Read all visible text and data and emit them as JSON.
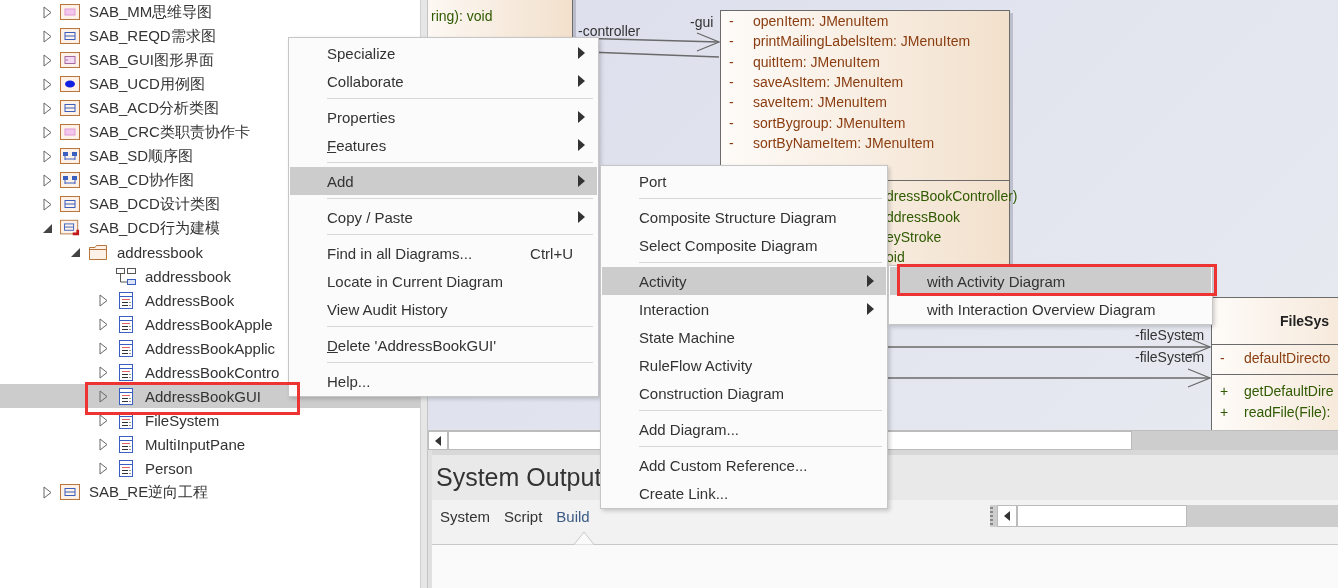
{
  "tree": {
    "items": [
      {
        "label": "SAB_MM思维导图",
        "kind": "mindmap",
        "expanded": false,
        "selected": false
      },
      {
        "label": "SAB_REQD需求图",
        "kind": "requirements",
        "expanded": false,
        "selected": false
      },
      {
        "label": "SAB_GUI图形界面",
        "kind": "gui",
        "expanded": false,
        "selected": false
      },
      {
        "label": "SAB_UCD用例图",
        "kind": "usecase",
        "expanded": false,
        "selected": false
      },
      {
        "label": "SAB_ACD分析类图",
        "kind": "analysis",
        "expanded": false,
        "selected": false
      },
      {
        "label": "SAB_CRC类职责协作卡",
        "kind": "crc",
        "expanded": false,
        "selected": false
      },
      {
        "label": "SAB_SD顺序图",
        "kind": "sequence",
        "expanded": false,
        "selected": false
      },
      {
        "label": "SAB_CD协作图",
        "kind": "collaboration",
        "expanded": false,
        "selected": false
      },
      {
        "label": "SAB_DCD设计类图",
        "kind": "analysis",
        "expanded": false,
        "selected": false
      },
      {
        "label": "SAB_DCD行为建模",
        "kind": "behavior",
        "expanded": true,
        "selected": false,
        "children": [
          {
            "label": "addressbook",
            "kind": "folder",
            "expanded": true,
            "selected": false,
            "children": [
              {
                "label": "addressbook",
                "kind": "diagram",
                "selected": false
              },
              {
                "label": "AddressBook",
                "kind": "class",
                "expanded": false,
                "selected": false
              },
              {
                "label": "AddressBookApple",
                "kind": "class",
                "expanded": false,
                "selected": false
              },
              {
                "label": "AddressBookApplic",
                "kind": "class",
                "expanded": false,
                "selected": false
              },
              {
                "label": "AddressBookContro",
                "kind": "class",
                "expanded": false,
                "selected": false
              },
              {
                "label": "AddressBookGUI",
                "kind": "class",
                "expanded": false,
                "selected": true,
                "highlighted": true
              },
              {
                "label": "FileSystem",
                "kind": "class",
                "expanded": false,
                "selected": false
              },
              {
                "label": "MultiInputPane",
                "kind": "class",
                "expanded": false,
                "selected": false
              },
              {
                "label": "Person",
                "kind": "class",
                "expanded": false,
                "selected": false
              }
            ]
          }
        ]
      },
      {
        "label": "SAB_RE逆向工程",
        "kind": "analysis",
        "expanded": false,
        "selected": false
      }
    ]
  },
  "diagram": {
    "classes": [
      {
        "operations": [
          {
            "text": "ring): void"
          }
        ]
      },
      {
        "attributes": [
          {
            "visibility": "-",
            "text": "openItem: JMenuItem"
          },
          {
            "visibility": "-",
            "text": "printMailingLabelsItem: JMenuItem"
          },
          {
            "visibility": "-",
            "text": "quitItem: JMenuItem"
          },
          {
            "visibility": "-",
            "text": "saveAsItem: JMenuItem"
          },
          {
            "visibility": "-",
            "text": "saveItem: JMenuItem"
          },
          {
            "visibility": "-",
            "text": "sortBygroup: JMenuItem"
          },
          {
            "visibility": "-",
            "text": "sortByNameItem: JMenuItem"
          }
        ],
        "operations": [
          {
            "text": "dressBookController)"
          },
          {
            "text": "ddressBook"
          },
          {
            "text": "eyStroke"
          },
          {
            "text": "oid"
          }
        ]
      },
      {
        "name": "FileSys",
        "attributes": [
          {
            "visibility": "-",
            "text": "defaultDirecto"
          }
        ],
        "operations": [
          {
            "visibility": "+",
            "text": "getDefaultDire"
          },
          {
            "visibility": "+",
            "text": "readFile(File):"
          }
        ]
      }
    ],
    "connectors": [
      {
        "kind": "association",
        "source_role": "-controller",
        "target_role": "-gui"
      },
      {
        "kind": "association"
      },
      {
        "kind": "association",
        "target_role": "-fileSystem"
      },
      {
        "kind": "association",
        "target_role": "-fileSystem"
      }
    ]
  },
  "context_menu": {
    "items": [
      {
        "kind": "item",
        "label": "Specialize",
        "submenu": true,
        "selected": false
      },
      {
        "kind": "item",
        "label": "Collaborate",
        "submenu": true,
        "selected": false
      },
      {
        "kind": "separator"
      },
      {
        "kind": "item",
        "label": "Properties",
        "submenu": true,
        "selected": false
      },
      {
        "kind": "item",
        "label": "Features",
        "submenu": true,
        "selected": false,
        "underline_first": true
      },
      {
        "kind": "separator"
      },
      {
        "kind": "item",
        "label": "Add",
        "submenu": true,
        "selected": true
      },
      {
        "kind": "separator"
      },
      {
        "kind": "item",
        "label": "Copy / Paste",
        "submenu": true,
        "selected": false
      },
      {
        "kind": "separator"
      },
      {
        "kind": "item",
        "label": "Find in all Diagrams...",
        "shortcut": "Ctrl+U",
        "submenu": false,
        "selected": false
      },
      {
        "kind": "item",
        "label": "Locate in Current Diagram",
        "submenu": false,
        "selected": false
      },
      {
        "kind": "item",
        "label": "View Audit History",
        "submenu": false,
        "selected": false
      },
      {
        "kind": "separator"
      },
      {
        "kind": "item",
        "label": "Delete 'AddressBookGUI'",
        "submenu": false,
        "selected": false,
        "underline_first": true
      },
      {
        "kind": "separator"
      },
      {
        "kind": "item",
        "label": "Help...",
        "submenu": false,
        "selected": false
      }
    ]
  },
  "add_submenu": {
    "items": [
      {
        "kind": "item",
        "label": "Port",
        "submenu": false,
        "selected": false
      },
      {
        "kind": "separator"
      },
      {
        "kind": "item",
        "label": "Composite Structure Diagram",
        "submenu": false,
        "selected": false
      },
      {
        "kind": "item",
        "label": "Select Composite Diagram",
        "submenu": false,
        "selected": false
      },
      {
        "kind": "separator"
      },
      {
        "kind": "item",
        "label": "Activity",
        "submenu": true,
        "selected": true
      },
      {
        "kind": "item",
        "label": "Interaction",
        "submenu": true,
        "selected": false
      },
      {
        "kind": "item",
        "label": "State Machine",
        "submenu": false,
        "selected": false
      },
      {
        "kind": "item",
        "label": "RuleFlow Activity",
        "submenu": false,
        "selected": false
      },
      {
        "kind": "item",
        "label": "Construction Diagram",
        "submenu": false,
        "selected": false
      },
      {
        "kind": "separator"
      },
      {
        "kind": "item",
        "label": "Add Diagram...",
        "submenu": false,
        "selected": false
      },
      {
        "kind": "separator"
      },
      {
        "kind": "item",
        "label": "Add Custom Reference...",
        "submenu": false,
        "selected": false
      },
      {
        "kind": "item",
        "label": "Create Link...",
        "submenu": false,
        "selected": false
      }
    ]
  },
  "activity_submenu": {
    "items": [
      {
        "kind": "item",
        "label": "with Activity Diagram",
        "submenu": false,
        "selected": true,
        "highlighted": true
      },
      {
        "kind": "item",
        "label": "with Interaction Overview Diagram",
        "submenu": false,
        "selected": false
      }
    ]
  },
  "output_panel": {
    "title": "System Output",
    "tabs": [
      {
        "label": "System",
        "selected": false
      },
      {
        "label": "Script",
        "selected": false
      },
      {
        "label": "Build",
        "selected": true
      }
    ]
  }
}
